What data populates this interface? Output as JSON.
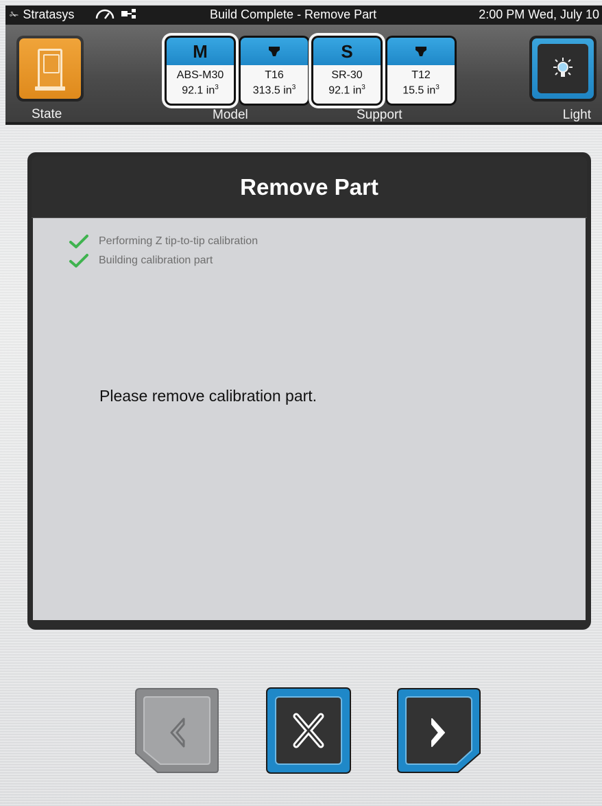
{
  "status_bar": {
    "brand": "Stratasys",
    "title": "Build Complete - Remove Part",
    "clock": "2:00 PM Wed, July 10"
  },
  "toolbar": {
    "state_label": "State",
    "model_label": "Model",
    "support_label": "Support",
    "light_label": "Light",
    "materials": [
      {
        "head": "M",
        "name": "ABS-M30",
        "volume": "92.1 in",
        "unit_exp": "3"
      },
      {
        "head": "",
        "icon": "tip-icon",
        "name": "T16",
        "volume": "313.5 in",
        "unit_exp": "3"
      },
      {
        "head": "S",
        "name": "SR-30",
        "volume": "92.1 in",
        "unit_exp": "3"
      },
      {
        "head": "",
        "icon": "tip-icon",
        "name": "T12",
        "volume": "15.5 in",
        "unit_exp": "3"
      }
    ]
  },
  "dialog": {
    "title": "Remove Part",
    "steps": [
      {
        "label": "Performing Z tip-to-tip calibration",
        "done": true
      },
      {
        "label": "Building calibration part",
        "done": true
      }
    ],
    "message": "Please remove calibration part."
  },
  "buttons": {
    "back": {
      "icon": "chevron-left-icon",
      "enabled": false
    },
    "cancel": {
      "icon": "close-icon",
      "enabled": true
    },
    "next": {
      "icon": "chevron-right-icon",
      "enabled": true
    }
  },
  "colors": {
    "accent_blue": "#1f88c8",
    "state_orange": "#e8962a",
    "check_green": "#3fb34f",
    "disabled_gray": "#8a8b8d"
  }
}
